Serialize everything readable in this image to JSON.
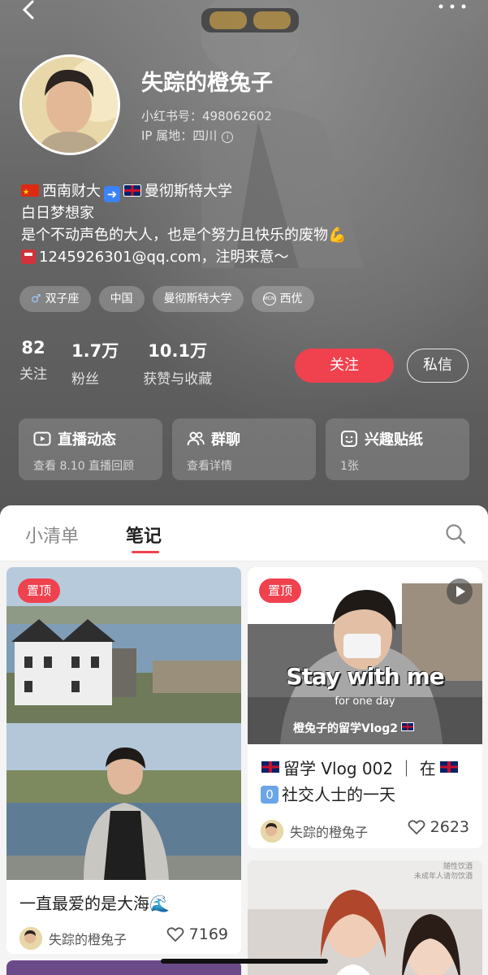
{
  "profile": {
    "nickname": "失踪的橙兔子",
    "redbook_id": "小红书号：498062602",
    "ip_location": "IP 属地：四川",
    "bio": {
      "line1_a": "西南财大",
      "line1_b": "曼彻斯特大学",
      "line2": "白日梦想家",
      "line3": "是个不动声色的大人，也是个努力且快乐的废物",
      "line4": "1245926301@qq.com，注明来意～"
    },
    "tags": [
      "双子座",
      "中国",
      "曼彻斯特大学",
      "西优"
    ],
    "stats": [
      {
        "value": "82",
        "label": "关注"
      },
      {
        "value": "1.7万",
        "label": "粉丝"
      },
      {
        "value": "10.1万",
        "label": "获赞与收藏"
      }
    ],
    "follow_label": "关注",
    "message_label": "私信",
    "cards": [
      {
        "title": "直播动态",
        "sub": "查看 8.10 直播回顾",
        "icon": "live-video-icon"
      },
      {
        "title": "群聊",
        "sub": "查看详情",
        "icon": "group-chat-icon"
      },
      {
        "title": "兴趣贴纸",
        "sub": "1张",
        "icon": "sticker-icon"
      }
    ]
  },
  "tabs": [
    "小清单",
    "笔记"
  ],
  "active_tab": "笔记",
  "notes": [
    {
      "pin_label": "置顶",
      "title": "一直最爱的是大海",
      "author": "失踪的橙兔子",
      "likes": "7169"
    },
    {
      "pin_label": "置顶",
      "cover_title": "Stay with me",
      "cover_sub": "for one day",
      "cover_caption": "橙兔子的留学Vlog2",
      "title_line1": "留学 Vlog 002 ｜ 在",
      "title_line2": "社交人士的一天",
      "author": "失踪的橙兔子",
      "likes": "2623"
    },
    {
      "cover_text_1": "随性饮酒",
      "cover_text_2": "未成年人请勿饮酒"
    }
  ],
  "colors": {
    "accent": "#f0414f",
    "header_bg": "#6a6a6a"
  }
}
